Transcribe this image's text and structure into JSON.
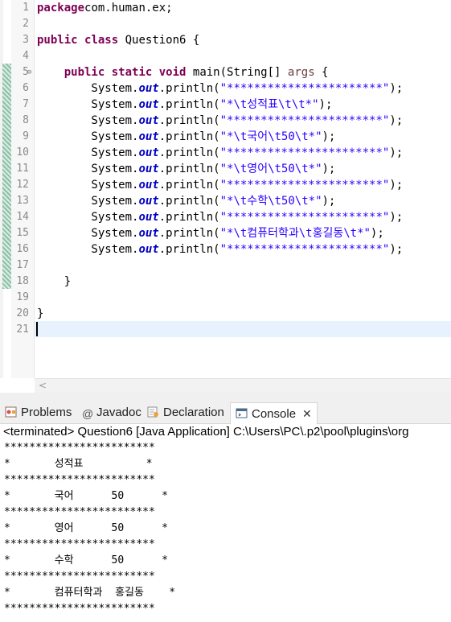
{
  "editor": {
    "lines": [
      {
        "n": "1",
        "t": [
          [
            "kw",
            "package"
          ],
          [
            "",
            "com.human.ex;"
          ]
        ]
      },
      {
        "n": "2",
        "t": []
      },
      {
        "n": "3",
        "t": [
          [
            "kw",
            "public"
          ],
          [
            "",
            " "
          ],
          [
            "kw",
            "class"
          ],
          [
            "",
            " Question6 {"
          ]
        ]
      },
      {
        "n": "4",
        "t": []
      },
      {
        "n": "5",
        "t": [
          [
            "",
            "    "
          ],
          [
            "kw",
            "public"
          ],
          [
            "",
            " "
          ],
          [
            "kw",
            "static"
          ],
          [
            "",
            " "
          ],
          [
            "kw",
            "void"
          ],
          [
            "",
            " main(String[] "
          ],
          [
            "par",
            "args"
          ],
          [
            "",
            " {"
          ]
        ]
      },
      {
        "n": "6",
        "t": [
          [
            "",
            "        System."
          ],
          [
            "fld",
            "out"
          ],
          [
            "",
            ".println("
          ],
          [
            "str",
            "\"***********************\""
          ],
          [
            "",
            ");"
          ]
        ]
      },
      {
        "n": "7",
        "t": [
          [
            "",
            "        System."
          ],
          [
            "fld",
            "out"
          ],
          [
            "",
            ".println("
          ],
          [
            "str",
            "\"*\\t성적표\\t\\t*\""
          ],
          [
            "",
            ");"
          ]
        ]
      },
      {
        "n": "8",
        "t": [
          [
            "",
            "        System."
          ],
          [
            "fld",
            "out"
          ],
          [
            "",
            ".println("
          ],
          [
            "str",
            "\"***********************\""
          ],
          [
            "",
            ");"
          ]
        ]
      },
      {
        "n": "9",
        "t": [
          [
            "",
            "        System."
          ],
          [
            "fld",
            "out"
          ],
          [
            "",
            ".println("
          ],
          [
            "str",
            "\"*\\t국어\\t50\\t*\""
          ],
          [
            "",
            ");"
          ]
        ]
      },
      {
        "n": "10",
        "t": [
          [
            "",
            "        System."
          ],
          [
            "fld",
            "out"
          ],
          [
            "",
            ".println("
          ],
          [
            "str",
            "\"***********************\""
          ],
          [
            "",
            ");"
          ]
        ]
      },
      {
        "n": "11",
        "t": [
          [
            "",
            "        System."
          ],
          [
            "fld",
            "out"
          ],
          [
            "",
            ".println("
          ],
          [
            "str",
            "\"*\\t영어\\t50\\t*\""
          ],
          [
            "",
            ");"
          ]
        ]
      },
      {
        "n": "12",
        "t": [
          [
            "",
            "        System."
          ],
          [
            "fld",
            "out"
          ],
          [
            "",
            ".println("
          ],
          [
            "str",
            "\"***********************\""
          ],
          [
            "",
            ");"
          ]
        ]
      },
      {
        "n": "13",
        "t": [
          [
            "",
            "        System."
          ],
          [
            "fld",
            "out"
          ],
          [
            "",
            ".println("
          ],
          [
            "str",
            "\"*\\t수학\\t50\\t*\""
          ],
          [
            "",
            ");"
          ]
        ]
      },
      {
        "n": "14",
        "t": [
          [
            "",
            "        System."
          ],
          [
            "fld",
            "out"
          ],
          [
            "",
            ".println("
          ],
          [
            "str",
            "\"***********************\""
          ],
          [
            "",
            ");"
          ]
        ]
      },
      {
        "n": "15",
        "t": [
          [
            "",
            "        System."
          ],
          [
            "fld",
            "out"
          ],
          [
            "",
            ".println("
          ],
          [
            "str",
            "\"*\\t컴퓨터학과\\t홍길동\\t*\""
          ],
          [
            "",
            ");"
          ]
        ]
      },
      {
        "n": "16",
        "t": [
          [
            "",
            "        System."
          ],
          [
            "fld",
            "out"
          ],
          [
            "",
            ".println("
          ],
          [
            "str",
            "\"***********************\""
          ],
          [
            "",
            ");"
          ]
        ]
      },
      {
        "n": "17",
        "t": []
      },
      {
        "n": "18",
        "t": [
          [
            "",
            "    }"
          ]
        ]
      },
      {
        "n": "19",
        "t": []
      },
      {
        "n": "20",
        "t": [
          [
            "",
            "}"
          ]
        ]
      },
      {
        "n": "21",
        "t": []
      }
    ],
    "fold_marker": "⊖"
  },
  "tabs": [
    {
      "id": "problems",
      "label": "Problems",
      "icon": "problems-icon"
    },
    {
      "id": "javadoc",
      "label": "Javadoc",
      "icon": "javadoc-icon"
    },
    {
      "id": "declaration",
      "label": "Declaration",
      "icon": "declaration-icon"
    },
    {
      "id": "console",
      "label": "Console",
      "icon": "console-icon",
      "close": "✕"
    }
  ],
  "console": {
    "header": "<terminated> Question6 [Java Application] C:\\Users\\PC\\.p2\\pool\\plugins\\org",
    "output": [
      "************************",
      "*       성적표          *",
      "************************",
      "*       국어      50      *",
      "************************",
      "*       영어      50      *",
      "************************",
      "*       수학      50      *",
      "************************",
      "*       컴퓨터학과  홍길동    *",
      "************************"
    ]
  },
  "colors": {
    "keyword": "#7f0055",
    "field": "#0000c0",
    "string": "#2a00ff",
    "current_line": "#e8f2fe"
  }
}
